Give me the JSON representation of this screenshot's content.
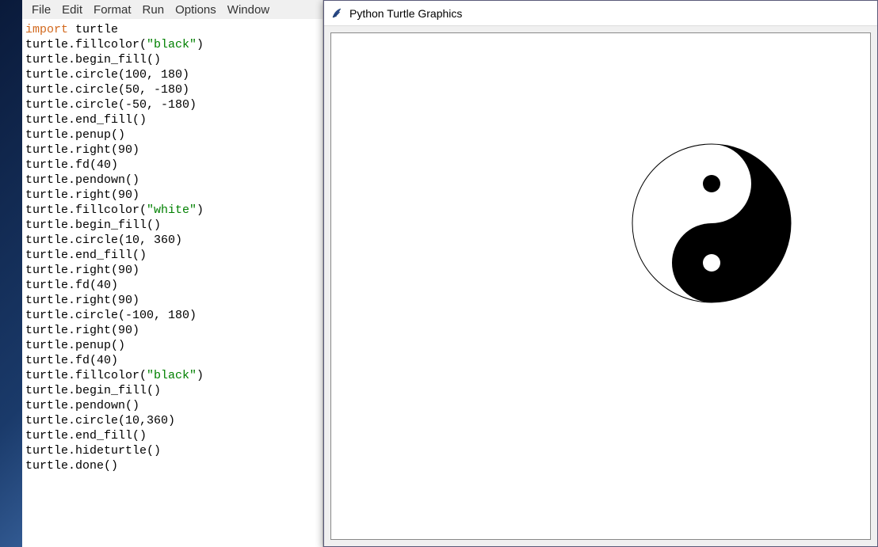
{
  "editor": {
    "menus": [
      "File",
      "Edit",
      "Format",
      "Run",
      "Options",
      "Window"
    ],
    "code_lines": [
      {
        "segments": [
          {
            "t": "import",
            "c": "kw-import"
          },
          {
            "t": " turtle",
            "c": ""
          }
        ]
      },
      {
        "segments": [
          {
            "t": "turtle.fillcolor(",
            "c": ""
          },
          {
            "t": "\"black\"",
            "c": "str-green"
          },
          {
            "t": ")",
            "c": ""
          }
        ]
      },
      {
        "segments": [
          {
            "t": "turtle.begin_fill()",
            "c": ""
          }
        ]
      },
      {
        "segments": [
          {
            "t": "turtle.circle(100, 180)",
            "c": ""
          }
        ]
      },
      {
        "segments": [
          {
            "t": "turtle.circle(50, -180)",
            "c": ""
          }
        ]
      },
      {
        "segments": [
          {
            "t": "turtle.circle(-50, -180)",
            "c": ""
          }
        ]
      },
      {
        "segments": [
          {
            "t": "turtle.end_fill()",
            "c": ""
          }
        ]
      },
      {
        "segments": [
          {
            "t": "turtle.penup()",
            "c": ""
          }
        ]
      },
      {
        "segments": [
          {
            "t": "turtle.right(90)",
            "c": ""
          }
        ]
      },
      {
        "segments": [
          {
            "t": "turtle.fd(40)",
            "c": ""
          }
        ]
      },
      {
        "segments": [
          {
            "t": "turtle.pendown()",
            "c": ""
          }
        ]
      },
      {
        "segments": [
          {
            "t": "turtle.right(90)",
            "c": ""
          }
        ]
      },
      {
        "segments": [
          {
            "t": "turtle.fillcolor(",
            "c": ""
          },
          {
            "t": "\"white\"",
            "c": "str-green"
          },
          {
            "t": ")",
            "c": ""
          }
        ]
      },
      {
        "segments": [
          {
            "t": "turtle.begin_fill()",
            "c": ""
          }
        ]
      },
      {
        "segments": [
          {
            "t": "turtle.circle(10, 360)",
            "c": ""
          }
        ]
      },
      {
        "segments": [
          {
            "t": "turtle.end_fill()",
            "c": ""
          }
        ]
      },
      {
        "segments": [
          {
            "t": "turtle.right(90)",
            "c": ""
          }
        ]
      },
      {
        "segments": [
          {
            "t": "turtle.fd(40)",
            "c": ""
          }
        ]
      },
      {
        "segments": [
          {
            "t": "turtle.right(90)",
            "c": ""
          }
        ]
      },
      {
        "segments": [
          {
            "t": "turtle.circle(-100, 180)",
            "c": ""
          }
        ]
      },
      {
        "segments": [
          {
            "t": "turtle.right(90)",
            "c": ""
          }
        ]
      },
      {
        "segments": [
          {
            "t": "turtle.penup()",
            "c": ""
          }
        ]
      },
      {
        "segments": [
          {
            "t": "turtle.fd(40)",
            "c": ""
          }
        ]
      },
      {
        "segments": [
          {
            "t": "turtle.fillcolor(",
            "c": ""
          },
          {
            "t": "\"black\"",
            "c": "str-green"
          },
          {
            "t": ")",
            "c": ""
          }
        ]
      },
      {
        "segments": [
          {
            "t": "turtle.begin_fill()",
            "c": ""
          }
        ]
      },
      {
        "segments": [
          {
            "t": "turtle.pendown()",
            "c": ""
          }
        ]
      },
      {
        "segments": [
          {
            "t": "turtle.circle(10,360)",
            "c": ""
          }
        ]
      },
      {
        "segments": [
          {
            "t": "turtle.end_fill()",
            "c": ""
          }
        ]
      },
      {
        "segments": [
          {
            "t": "turtle.hideturtle()",
            "c": ""
          }
        ]
      },
      {
        "segments": [
          {
            "t": "turtle.done()",
            "c": ""
          }
        ]
      }
    ]
  },
  "turtle_window": {
    "title": "Python Turtle Graphics",
    "icon": "feather-icon"
  },
  "chart_data": {
    "type": "diagram",
    "description": "Yin-yang (taijitu) symbol drawn by turtle graphics",
    "big_circle_radius": 100,
    "small_circle_radius": 50,
    "dot_radius": 10,
    "colors": {
      "dark": "#000000",
      "light": "#ffffff",
      "outline": "#000000"
    },
    "dots": [
      {
        "side": "light-half",
        "fill": "black"
      },
      {
        "side": "dark-half",
        "fill": "white"
      }
    ]
  }
}
